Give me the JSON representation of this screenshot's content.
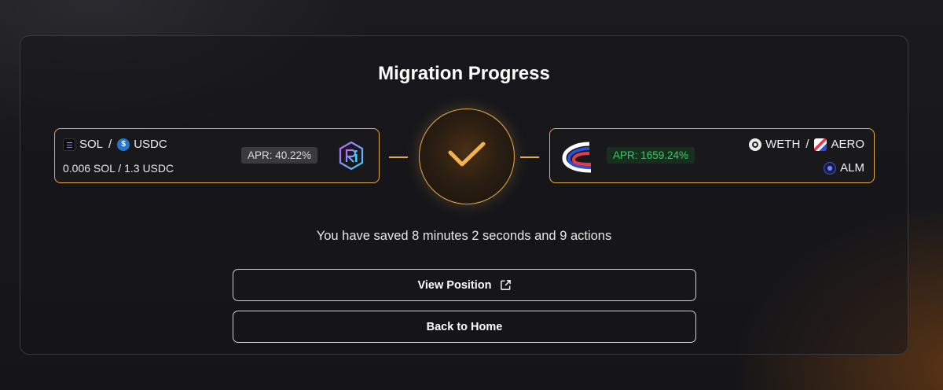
{
  "title": "Migration Progress",
  "source": {
    "token_a": "SOL",
    "separator": "/",
    "token_b": "USDC",
    "amount": "0.006 SOL / 1.3 USDC",
    "apr": "APR: 40.22%",
    "dex_icon": "raydium-logo-icon"
  },
  "destination": {
    "token_a": "WETH",
    "separator": "/",
    "token_b": "AERO",
    "manager": "ALM",
    "apr": "APR: 1659.24%",
    "dex_icon": "velodrome-logo-icon"
  },
  "status_icon": "checkmark-icon",
  "saved_text": "You have saved 8 minutes 2 seconds and 9 actions",
  "buttons": {
    "view_position": "View Position",
    "back_home": "Back to Home"
  },
  "colors": {
    "accent": "#e9a94a",
    "apr_green": "#2fcf63",
    "usdc_blue": "#2775ca"
  }
}
